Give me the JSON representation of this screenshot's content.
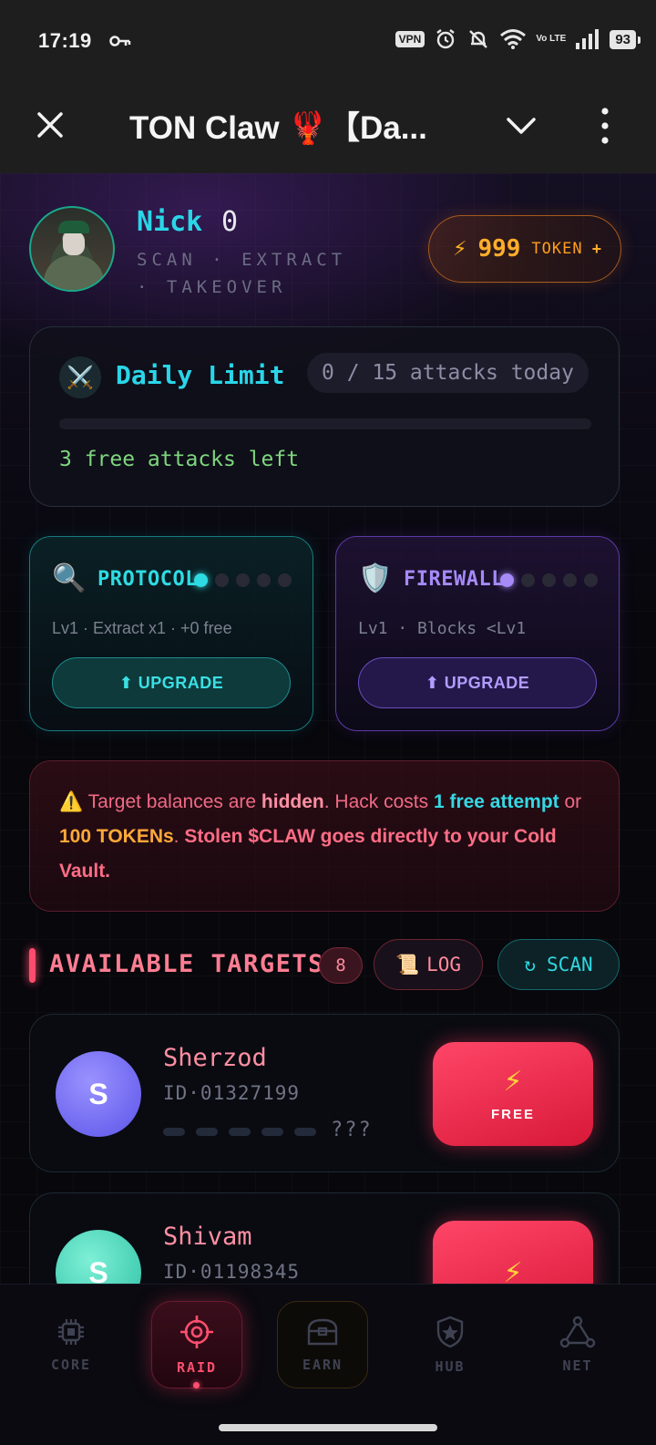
{
  "status_bar": {
    "time": "17:19",
    "vpn": "VPN",
    "volte": "Vo LTE",
    "battery": "93"
  },
  "title_bar": {
    "title": "TON Claw 🦞【Da..."
  },
  "profile": {
    "name": "Nick",
    "number": "0",
    "tagline": "SCAN · EXTRACT · TAKEOVER"
  },
  "token": {
    "bolt": "⚡",
    "value": "999",
    "unit": "TOKEN",
    "plus": "+",
    "color": "#ffae2a"
  },
  "daily_limit": {
    "icon": "⚔️",
    "title": "Daily Limit",
    "count": "0 / 15 attacks today",
    "progress": 0,
    "free_left": "3 free attacks left"
  },
  "upgrades": [
    {
      "icon": "🔍",
      "name": "PROTOCOL",
      "level_dots": 1,
      "desc": "Lv1 · Extract x1 · +0 free",
      "button": "⬆ UPGRADE",
      "color": "#2fdbe3"
    },
    {
      "icon": "🛡️",
      "name": "FIREWALL",
      "level_dots": 1,
      "desc": "Lv1  ·  Blocks <Lv1",
      "button": "⬆ UPGRADE",
      "color": "#a58af8"
    }
  ],
  "warning": {
    "icon": "⚠️",
    "t1": " Target balances are ",
    "b1": "hidden",
    "t2": ". Hack costs ",
    "b2": "1 free attempt",
    "t3": " or ",
    "b3": "100 TOKENs",
    "t4": ". ",
    "b4": "Stolen $CLAW goes directly to your Cold Vault."
  },
  "targets": {
    "title": "AVAILABLE TARGETS",
    "count": "8",
    "log_icon": "📜",
    "log_label": "LOG",
    "scan_icon": "↻",
    "scan_label": "SCAN",
    "items": [
      {
        "initial": "S",
        "name": "Sherzod",
        "id": "ID·01327199",
        "balance": "???",
        "button_icon": "⚡",
        "button_label": "FREE",
        "avatar_color": "#7b72f5"
      },
      {
        "initial": "S",
        "name": "Shivam",
        "id": "ID·01198345",
        "balance": "",
        "button_icon": "⚡",
        "button_label": "",
        "avatar_color": "#3fd6b8"
      }
    ]
  },
  "bottom_nav": {
    "items": [
      {
        "label": "CORE",
        "icon": "chip-icon"
      },
      {
        "label": "RAID",
        "icon": "crosshair-icon",
        "active": true
      },
      {
        "label": "EARN",
        "icon": "chest-icon"
      },
      {
        "label": "HUB",
        "icon": "shield-star-icon"
      },
      {
        "label": "NET",
        "icon": "network-icon"
      }
    ]
  }
}
